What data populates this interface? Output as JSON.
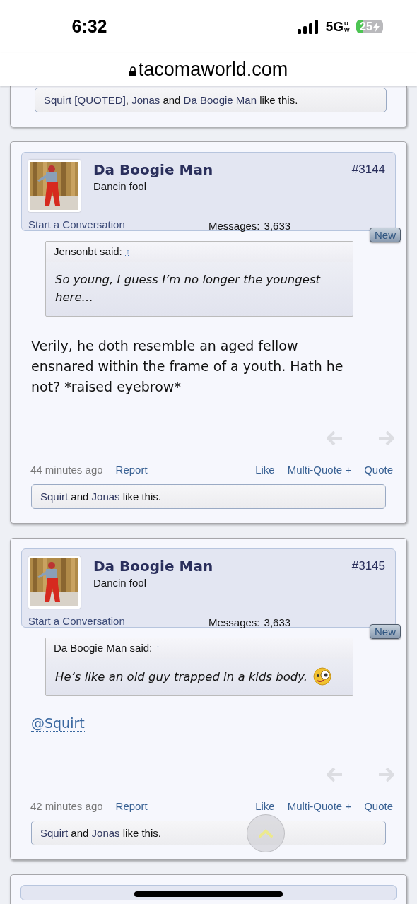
{
  "status_bar": {
    "time": "6:32",
    "network": "5G",
    "network_sub": "UW",
    "battery": "25",
    "charging": true
  },
  "address_bar": {
    "domain": "tacomaworld.com",
    "secure": true
  },
  "posts": [
    {
      "kind": "cut_top",
      "likes": [
        {
          "text": "Squirt [QUOTED]",
          "link": true
        },
        {
          "text": ",",
          "link": false
        },
        {
          "text": "Jonas",
          "link": true
        },
        {
          "text": "and",
          "link": false
        },
        {
          "text": "Da Boogie Man",
          "link": true
        },
        {
          "text": "like this.",
          "link": false
        }
      ]
    },
    {
      "kind": "full",
      "user": "Da Boogie Man",
      "user_title": "Dancin fool",
      "number": "#3144",
      "conversation": "Start a Conversation",
      "messages_label": "Messages:",
      "messages": "3,633",
      "badge": "New",
      "quote": {
        "author": "Jensonbt said:",
        "jump": "↑",
        "text": "So young, I guess I’m no longer the youngest here…",
        "smiley": false
      },
      "body": {
        "kind": "text",
        "text": "Verily, he doth resemble an aged fellow ensnared within the frame of a youth. Hath he not? *raised eyebrow*"
      },
      "time": "44 minutes ago",
      "actions_left": [
        "Report"
      ],
      "actions_right": [
        "Like",
        "Multi-Quote +",
        "Quote"
      ],
      "likes": [
        {
          "text": "Squirt",
          "link": true
        },
        {
          "text": "and",
          "link": false
        },
        {
          "text": "Jonas",
          "link": true
        },
        {
          "text": "like this.",
          "link": false
        }
      ]
    },
    {
      "kind": "full",
      "user": "Da Boogie Man",
      "user_title": "Dancin fool",
      "number": "#3145",
      "conversation": "Start a Conversation",
      "messages_label": "Messages:",
      "messages": "3,633",
      "badge": "New",
      "quote": {
        "author": "Da Boogie Man said:",
        "jump": "↑",
        "text": "He’s like an old guy trapped in a kids body.",
        "smiley": true
      },
      "body": {
        "kind": "mention",
        "text": "@Squirt"
      },
      "time": "42 minutes ago",
      "actions_left": [
        "Report"
      ],
      "actions_right": [
        "Like",
        "Multi-Quote +",
        "Quote"
      ],
      "likes": [
        {
          "text": "Squirt",
          "link": true
        },
        {
          "text": "and",
          "link": false
        },
        {
          "text": "Jonas",
          "link": true
        },
        {
          "text": "like this.",
          "link": false
        }
      ]
    },
    {
      "kind": "cut_bottom"
    }
  ]
}
